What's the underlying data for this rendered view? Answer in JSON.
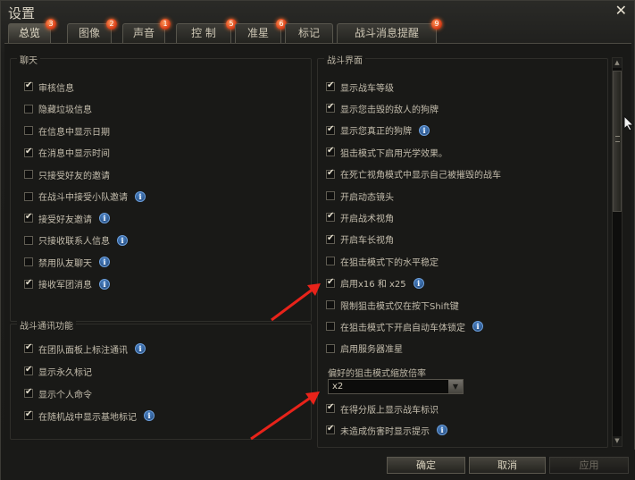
{
  "window": {
    "title": "设置",
    "close_glyph": "✕"
  },
  "tabs": [
    {
      "label": "总览",
      "badge": "3",
      "active": true
    },
    {
      "label": "图像",
      "badge": "2",
      "active": false
    },
    {
      "label": "声音",
      "badge": "1",
      "active": false
    },
    {
      "label": "控  制",
      "badge": "5",
      "active": false
    },
    {
      "label": "准星",
      "badge": "6",
      "active": false
    },
    {
      "label": "标记",
      "badge": "",
      "active": false
    },
    {
      "label": "战斗消息提醒",
      "badge": "9",
      "active": false
    }
  ],
  "chat": {
    "title": "聊天",
    "items": [
      {
        "label": "审核信息",
        "checked": true,
        "info": false
      },
      {
        "label": "隐藏垃圾信息",
        "checked": false,
        "info": false
      },
      {
        "label": "在信息中显示日期",
        "checked": false,
        "info": false
      },
      {
        "label": "在消息中显示时间",
        "checked": true,
        "info": false
      },
      {
        "label": "只接受好友的邀请",
        "checked": false,
        "info": false
      },
      {
        "label": "在战斗中接受小队邀请",
        "checked": false,
        "info": true
      },
      {
        "label": "接受好友邀请",
        "checked": true,
        "info": true
      },
      {
        "label": "只接收联系人信息",
        "checked": false,
        "info": true
      },
      {
        "label": "禁用队友聊天",
        "checked": false,
        "info": true
      },
      {
        "label": "接收军团消息",
        "checked": true,
        "info": true
      }
    ]
  },
  "battle_comm": {
    "title": "战斗通讯功能",
    "items": [
      {
        "label": "在团队面板上标注通讯",
        "checked": true,
        "info": true
      },
      {
        "label": "显示永久标记",
        "checked": true,
        "info": false
      },
      {
        "label": "显示个人命令",
        "checked": true,
        "info": false
      },
      {
        "label": "在随机战中显示基地标记",
        "checked": true,
        "info": true
      }
    ]
  },
  "battle_ui": {
    "title": "战斗界面",
    "items": [
      {
        "label": "显示战车等级",
        "checked": true,
        "info": false
      },
      {
        "label": "显示您击毁的敌人的狗牌",
        "checked": true,
        "info": false
      },
      {
        "label": "显示您真正的狗牌",
        "checked": true,
        "info": true
      },
      {
        "label": "狙击模式下启用光学效果。",
        "checked": true,
        "info": false
      },
      {
        "label": "在死亡视角模式中显示自己被摧毁的战车",
        "checked": true,
        "info": false
      },
      {
        "label": "开启动态镜头",
        "checked": false,
        "info": false
      },
      {
        "label": "开启战术视角",
        "checked": true,
        "info": false
      },
      {
        "label": "开启车长视角",
        "checked": true,
        "info": false
      },
      {
        "label": "在狙击模式下的水平稳定",
        "checked": false,
        "info": false
      },
      {
        "label": "启用x16 和 x25",
        "checked": true,
        "info": true
      },
      {
        "label": "限制狙击模式仅在按下Shift键",
        "checked": false,
        "info": false
      },
      {
        "label": "在狙击模式下开启自动车体锁定",
        "checked": false,
        "info": true
      },
      {
        "label": "启用服务器准星",
        "checked": false,
        "info": false
      }
    ],
    "zoom_label": "偏好的狙击模式缩放倍率",
    "zoom_value": "x2",
    "after_items": [
      {
        "label": "在得分版上显示战车标识",
        "checked": true,
        "info": false
      },
      {
        "label": "未造成伤害时显示提示",
        "checked": true,
        "info": true
      }
    ]
  },
  "info_glyph": "i",
  "footer": {
    "ok": "确定",
    "cancel": "取消",
    "apply": "应用"
  },
  "colors": {
    "accent_arrow": "#e8231a",
    "badge": "#d9401a",
    "info": "#2f67a8"
  },
  "icons": {
    "checkbox": "checkmark",
    "info": "info-icon",
    "dropdown": "chevron-down-icon",
    "close": "close-icon"
  }
}
